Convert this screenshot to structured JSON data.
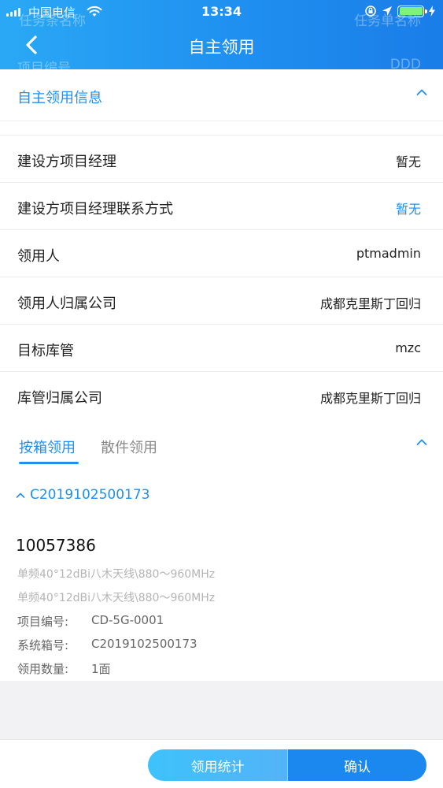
{
  "status_bar": {
    "carrier": "中国电信",
    "time": "13:34"
  },
  "header": {
    "title": "自主领用",
    "bg_ghost": {
      "top_left": "任务条名称",
      "top_right": "任务单名称",
      "bottom_left": "项目编号",
      "bottom_right": "DDD"
    }
  },
  "info_section": {
    "title": "自主领用信息",
    "rows": [
      {
        "label": "建设方项目经理",
        "value": "暂无"
      },
      {
        "label": "建设方项目经理联系方式",
        "value": "暂无"
      },
      {
        "label": "领用人",
        "value": "ptmadmin"
      },
      {
        "label": "领用人归属公司",
        "value": "成都克里斯丁回归"
      },
      {
        "label": "目标库管",
        "value": "mzc"
      },
      {
        "label": "库管归属公司",
        "value": "成都克里斯丁回归"
      }
    ]
  },
  "tabs": {
    "active": "按箱领用",
    "inactive": "散件领用"
  },
  "box": {
    "code": "C2019102500173",
    "item": {
      "code": "10057386",
      "spec_line1": "单频40°12dBi八木天线\\880～960MHz",
      "spec_line2": "单频40°12dBi八木天线\\880～960MHz",
      "project_label": "项目编号:",
      "project_value": "CD-5G-0001",
      "system_label": "系统箱号:",
      "system_value": "C2019102500173",
      "qty_label": "领用数量:",
      "qty_value": "1面"
    }
  },
  "footer": {
    "stats_label": "领用统计",
    "confirm_label": "确认"
  },
  "colors": {
    "accent": "#1f8ff0",
    "battery": "#7ef27a"
  }
}
